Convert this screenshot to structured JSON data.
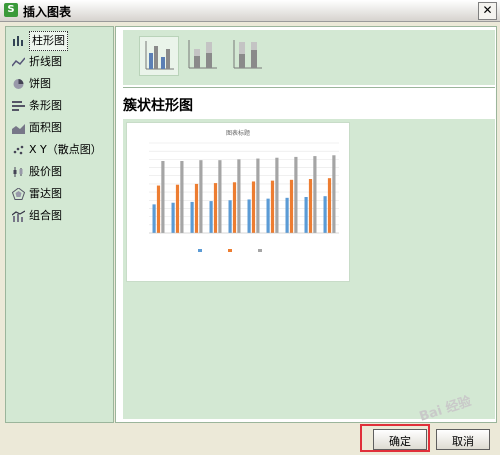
{
  "window": {
    "title": "插入图表",
    "app_icon": "S"
  },
  "left_panel": {
    "items": [
      {
        "label": "柱形图",
        "icon": "column-chart-icon"
      },
      {
        "label": "折线图",
        "icon": "line-chart-icon"
      },
      {
        "label": "饼图",
        "icon": "pie-chart-icon"
      },
      {
        "label": "条形图",
        "icon": "bar-chart-icon"
      },
      {
        "label": "面积图",
        "icon": "area-chart-icon"
      },
      {
        "label": "X Y（散点图）",
        "icon": "scatter-chart-icon"
      },
      {
        "label": "股价图",
        "icon": "stock-chart-icon"
      },
      {
        "label": "雷达图",
        "icon": "radar-chart-icon"
      },
      {
        "label": "组合图",
        "icon": "combo-chart-icon"
      }
    ],
    "selected": 0
  },
  "right_panel": {
    "subtypes": [
      "clustered-column",
      "stacked-column",
      "percent-stacked-column"
    ],
    "selected_subtype": 0,
    "preview_title": "簇状柱形图"
  },
  "chart_data": {
    "type": "bar",
    "title": "图表标题",
    "categories": [
      "",
      "",
      "",
      "",
      "",
      "",
      "",
      "",
      "",
      ""
    ],
    "series": [
      {
        "values": [
          35,
          37,
          38,
          39,
          40,
          41,
          42,
          43,
          44,
          45
        ],
        "color": "#5b9bd5"
      },
      {
        "values": [
          58,
          59,
          60,
          61,
          62,
          63,
          64,
          65,
          66,
          67
        ],
        "color": "#ed7d31"
      },
      {
        "values": [
          88,
          88,
          89,
          89,
          90,
          91,
          92,
          93,
          94,
          95
        ],
        "color": "#a5a5a5"
      }
    ],
    "ylim": [
      0,
      110
    ],
    "grid": true,
    "legend": "bottom"
  },
  "buttons": {
    "ok": "确定",
    "cancel": "取消"
  },
  "colors": {
    "panel_bg": "#d3e8d3",
    "highlight": "#e0303a"
  },
  "watermark": "Bai 经验"
}
